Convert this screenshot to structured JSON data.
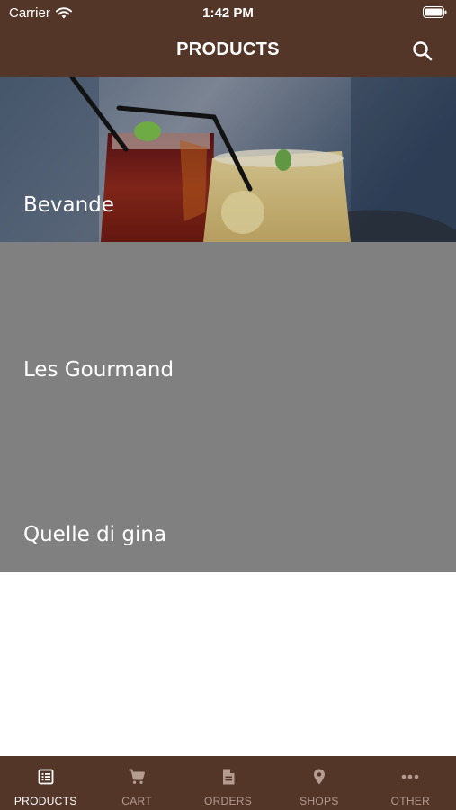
{
  "status_bar": {
    "carrier": "Carrier",
    "time": "1:42 PM"
  },
  "header": {
    "title": "PRODUCTS",
    "search_icon": "search-icon"
  },
  "categories": [
    {
      "label": "Bevande",
      "has_image": true
    },
    {
      "label": "Les Gourmand",
      "has_image": false
    },
    {
      "label": "Quelle di gina",
      "has_image": false
    }
  ],
  "tabbar": {
    "active": "PRODUCTS",
    "tabs": [
      {
        "label": "PRODUCTS",
        "icon": "list-icon"
      },
      {
        "label": "CART",
        "icon": "cart-icon"
      },
      {
        "label": "ORDERS",
        "icon": "document-icon"
      },
      {
        "label": "SHOPS",
        "icon": "map-pin-icon"
      },
      {
        "label": "OTHER",
        "icon": "more-dots-icon"
      }
    ]
  },
  "colors": {
    "brand": "#543629",
    "tile_gray": "#808080",
    "tab_inactive": "#b49c90"
  }
}
